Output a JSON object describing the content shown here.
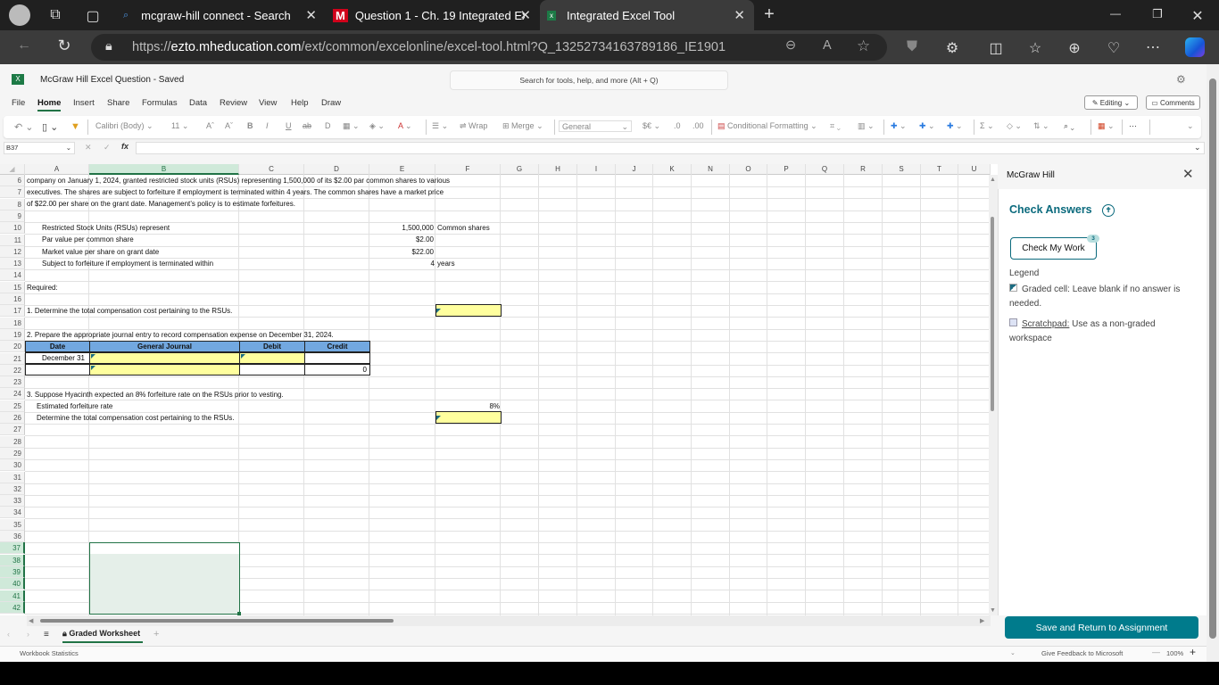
{
  "browser": {
    "tabs": [
      {
        "title": "mcgraw-hill connect - Search",
        "icon": "search-icon",
        "active": false
      },
      {
        "title": "Question 1 - Ch. 19 Integrated Ex",
        "icon": "mcgraw-hill-m-icon",
        "active": false
      },
      {
        "title": "Integrated Excel Tool",
        "icon": "excel-icon",
        "active": true
      }
    ],
    "url_prefix": "https://",
    "url_domain": "ezto.mheducation.com",
    "url_path": "/ext/common/excelonline/excel-tool.html?Q_13252734163789186_IE1901",
    "new_tab": "+",
    "window_controls": {
      "minimize": "—",
      "restore": "❐",
      "close": "✕"
    }
  },
  "excel": {
    "doc_title": "McGraw Hill Excel Question  -  Saved",
    "search_placeholder": "Search for tools, help, and more (Alt + Q)",
    "menu": [
      "File",
      "Home",
      "Insert",
      "Share",
      "Formulas",
      "Data",
      "Review",
      "View",
      "Help",
      "Draw"
    ],
    "active_menu": "Home",
    "editing_label": "Editing",
    "comments_label": "Comments",
    "ribbon": {
      "font_name": "Calibri (Body)",
      "font_size": "11",
      "wrap": "Wrap",
      "merge": "Merge",
      "number_format": "General",
      "conditional_formatting": "Conditional Formatting"
    },
    "name_box": "B37",
    "formula": "",
    "columns": [
      "A",
      "B",
      "C",
      "D",
      "E",
      "F",
      "G",
      "H",
      "I",
      "J",
      "K",
      "N",
      "O",
      "P",
      "Q",
      "R",
      "S",
      "T",
      "U"
    ],
    "selected_column": "B",
    "rows": [
      "6",
      "7",
      "8",
      "9",
      "10",
      "11",
      "12",
      "13",
      "14",
      "15",
      "16",
      "17",
      "18",
      "19",
      "20",
      "21",
      "22",
      "23",
      "24",
      "25",
      "26",
      "27",
      "28",
      "29",
      "30",
      "31",
      "32",
      "33",
      "34",
      "35",
      "36",
      "37",
      "38",
      "39",
      "40",
      "41",
      "42"
    ],
    "selected_rows": [
      "37",
      "38",
      "39",
      "40",
      "41",
      "42"
    ],
    "cells": {
      "A6": "company on January 1, 2024, granted restricted stock units (RSUs) representing 1,500,000 of its $2.00 par common shares to various",
      "A7": "executives.  The shares are subject to forfeiture if employment is terminated within 4 years.  The common shares have a market price",
      "A8": "of $22.00 per share on the grant date.  Management’s policy is to estimate forfeitures.",
      "A10": "Restricted Stock Units (RSUs) represent",
      "E10": "1,500,000",
      "F10": "Common shares",
      "A11": "Par value per common share",
      "E11": "$2.00",
      "A12": "Market value per share on grant date",
      "E12": "$22.00",
      "A13": "Subject to forfeiture if employment is terminated within",
      "E13": "4",
      "F13": "years",
      "A15": "Required:",
      "A17": "1. Determine the total compensation cost pertaining to the RSUs.",
      "A19": "2. Prepare the appropriate journal entry to record compensation expense on December 31, 2024.",
      "A24": "3. Suppose Hyacinth expected an 8% forfeiture rate on the RSUs prior to vesting.",
      "A25": "Estimated forfeiture rate",
      "F25": "8%",
      "A26": "Determine the total compensation cost pertaining to the RSUs."
    },
    "journal": {
      "headers": [
        "Date",
        "General Journal",
        "Debit",
        "Credit"
      ],
      "rows": [
        {
          "date": "December 31",
          "account": "",
          "debit": "",
          "credit": ""
        },
        {
          "date": "",
          "account": "",
          "debit": "",
          "credit": "0"
        }
      ]
    },
    "answer_cells": {
      "F17": "",
      "F26": ""
    },
    "sheet_tab": "Graded Worksheet",
    "status_left": "Workbook Statistics",
    "feedback": "Give Feedback to Microsoft",
    "zoom": "100%"
  },
  "pane": {
    "header": "McGraw Hill",
    "check_answers": "Check Answers",
    "check_my_work": "Check My Work",
    "checks_remaining": "3",
    "legend_title": "Legend",
    "legend_graded": "Graded cell: Leave blank if no answer is needed.",
    "legend_scratch_link": "Scratchpad:",
    "legend_scratch_text": " Use as a non-graded workspace",
    "save_return": "Save and Return to Assignment"
  },
  "colors": {
    "excel_green": "#217346",
    "teal": "#0b6a7d",
    "save_button": "#007b8c",
    "answer_yellow": "#ffff9e",
    "journal_header_blue": "#72a8e0"
  }
}
